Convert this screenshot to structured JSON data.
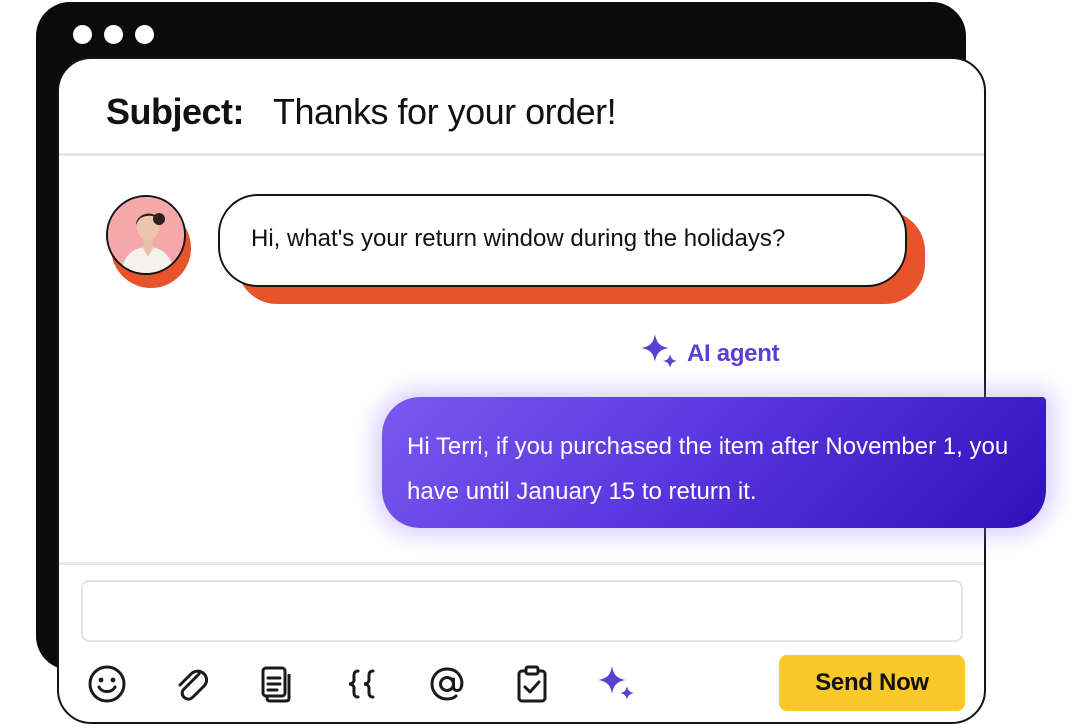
{
  "window": {
    "controls": [
      "dot",
      "dot",
      "dot"
    ]
  },
  "email": {
    "subject_label": "Subject:",
    "subject_value": "Thanks for your order!"
  },
  "conversation": {
    "customer_message": "Hi, what's your return window during the holidays?",
    "agent_label": "AI agent",
    "agent_message": "Hi Terri, if you purchased the item after November 1, you have until January 15 to return it."
  },
  "composer": {
    "input_value": "",
    "toolbar_icons": [
      "emoji-icon",
      "paperclip-icon",
      "document-icon",
      "curly-braces-icon",
      "at-sign-icon",
      "clipboard-check-icon",
      "sparkle-icon"
    ],
    "send_label": "Send Now"
  },
  "colors": {
    "accent_orange": "#e8542a",
    "ai_purple": "#5b3fd1",
    "send_yellow": "#f8c928"
  }
}
